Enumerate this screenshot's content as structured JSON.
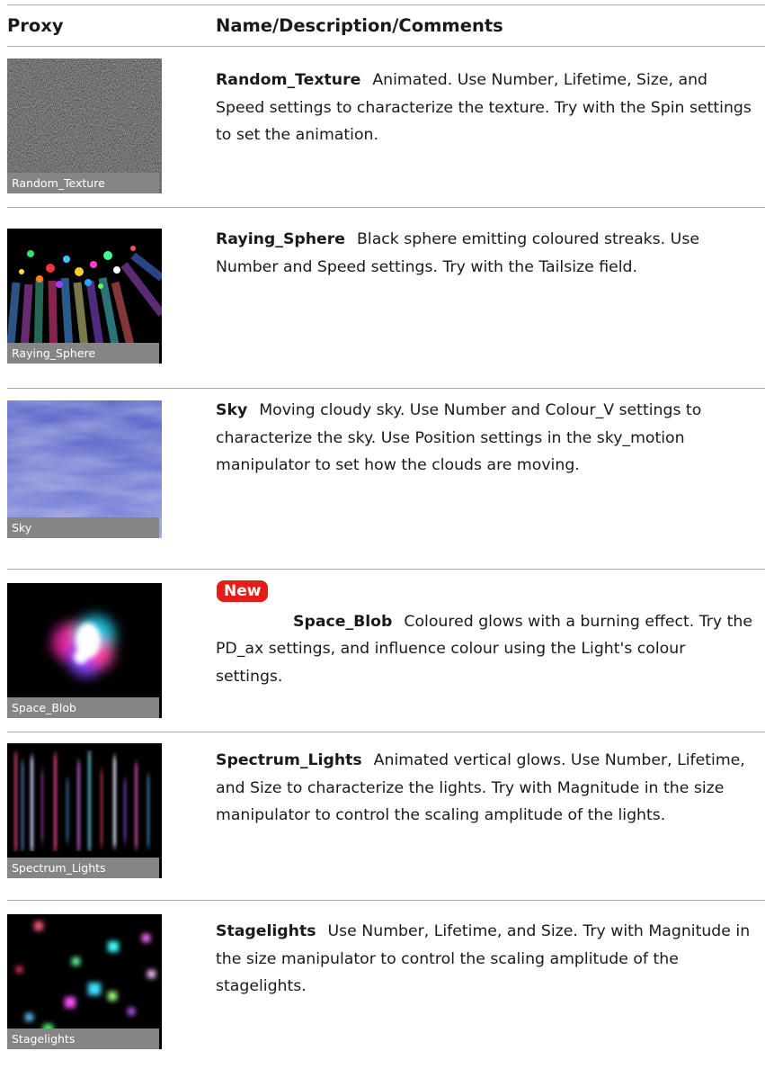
{
  "table": {
    "headers": {
      "proxy": "Proxy",
      "name": "Name/Description/Comments"
    },
    "rows": [
      {
        "label": "Random_Texture",
        "name": "Random_Texture",
        "description": "Animated. Use Number, Lifetime, Size, and Speed settings to characterize the texture. Try with the Spin settings to set the animation.",
        "badge": ""
      },
      {
        "label": "Raying_Sphere",
        "name": "Raying_Sphere",
        "description": "Black sphere emitting coloured streaks. Use Number and Speed settings. Try with the Tailsize field.",
        "badge": ""
      },
      {
        "label": "Sky",
        "name": "Sky",
        "description": "Moving cloudy sky. Use Number and Colour_V settings to characterize the sky. Use Position settings in the sky_motion manipulator to set how the clouds are moving.",
        "badge": ""
      },
      {
        "label": "Space_Blob",
        "name": "Space_Blob",
        "description": "Coloured glows with a burning effect. Try the PD_ax settings, and influence colour using the Light's colour settings.",
        "badge": "New"
      },
      {
        "label": "Spectrum_Lights",
        "name": "Spectrum_Lights",
        "description": "Animated vertical glows. Use Number, Lifetime, and Size to characterize the lights. Try with Magnitude in the size manipulator to control the scaling amplitude of the lights.",
        "badge": ""
      },
      {
        "label": "Stagelights",
        "name": "Stagelights",
        "description": "Use Number, Lifetime, and Size. Try with Magnitude in the size manipulator to control the scaling amplitude of the stagelights.",
        "badge": ""
      }
    ]
  },
  "colors": {
    "rule": "#a9a9a9",
    "label_bg": "#858585",
    "badge_bg": "#e41e16"
  }
}
